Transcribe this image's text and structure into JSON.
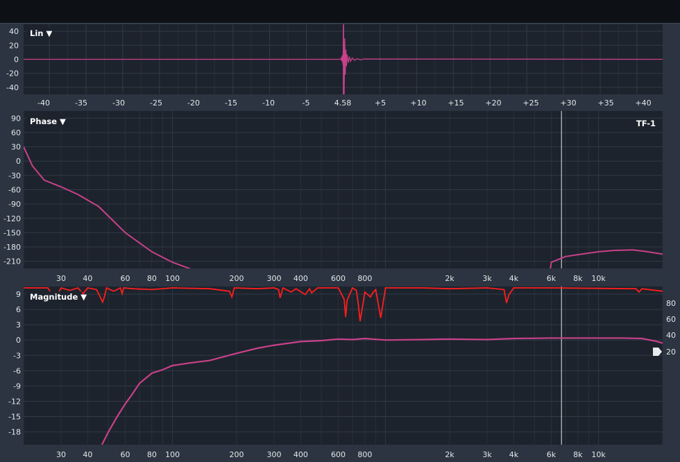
{
  "chart_data": [
    {
      "type": "line",
      "title": "Lin",
      "mode_label": "Lin ▼",
      "xlim": [
        -43.5,
        43.5
      ],
      "ylim": [
        -50,
        50
      ],
      "y_ticks": [
        "40",
        "20",
        "0",
        "-20",
        "-40"
      ],
      "x_ticks": [
        "-40",
        "-35",
        "-30",
        "-25",
        "-20",
        "-15",
        "-10",
        "-5",
        "4.58",
        "+5",
        "+10",
        "+15",
        "+20",
        "+25",
        "+30",
        "+35",
        "+40"
      ],
      "grid": true,
      "impulse_peak_time": 4.58,
      "series": [
        {
          "x": [
            -43.5,
            2.9,
            3.0,
            3.1,
            3.2,
            3.3,
            3.4,
            3.5,
            3.6,
            3.7,
            3.8,
            3.9,
            4.0,
            4.2,
            4.4,
            4.6,
            4.9,
            5.3,
            5.8,
            6.3,
            7.0,
            43.5
          ],
          "y": [
            0,
            0,
            2,
            -3,
            6,
            -8,
            48,
            -50,
            30,
            -22,
            14,
            -10,
            7,
            -5,
            4,
            -3,
            2,
            -1.5,
            1,
            -0.7,
            0.5,
            0
          ]
        }
      ]
    },
    {
      "type": "line",
      "title": "Phase",
      "mode_label": "Phase ▼",
      "tag": "TF-1",
      "xscale": "log",
      "xlim": [
        20,
        20000
      ],
      "ylim": [
        -225,
        105
      ],
      "y_ticks": [
        "90",
        "60",
        "30",
        "0",
        "-30",
        "-60",
        "-90",
        "-120",
        "-150",
        "-180",
        "-210"
      ],
      "x_ticks": [
        "30",
        "40",
        "60",
        "80",
        "100",
        "200",
        "300",
        "400",
        "600",
        "800",
        "2k",
        "3k",
        "4k",
        "6k",
        "8k",
        "10k"
      ],
      "grid": true,
      "cursor_hz": 6700,
      "series": [
        {
          "x": [
            20,
            22,
            25,
            30,
            36,
            45,
            60,
            80,
            100,
            120,
            150,
            175,
            200,
            260,
            330,
            420,
            560,
            640,
            700,
            800,
            1000,
            1500,
            2000,
            3000,
            4000,
            5000,
            5600,
            6000,
            7000,
            8000,
            10000,
            12000,
            14500,
            17000,
            20000
          ],
          "y": [
            30,
            -10,
            -40,
            -54,
            -70,
            -95,
            -150,
            -190,
            -212,
            -225,
            177,
            168,
            158,
            145,
            135,
            132,
            124,
            125,
            127,
            135,
            136,
            142,
            148,
            151,
            158,
            172,
            179,
            -212,
            -200,
            -196,
            -190,
            -187,
            -186,
            -190,
            -195
          ]
        }
      ]
    },
    {
      "type": "line",
      "title": "Magnitude",
      "mode_label": "Magnitude ▼",
      "xscale": "log",
      "xlim": [
        20,
        20000
      ],
      "ylim": [
        -20.5,
        10.5
      ],
      "y_ticks": [
        "9",
        "6",
        "3",
        "0",
        "-3",
        "-6",
        "-9",
        "-12",
        "-15",
        "-18"
      ],
      "y2_ticks": [
        "80",
        "60",
        "40",
        "20"
      ],
      "y2lim": [
        11,
        100
      ],
      "x_ticks": [
        "30",
        "40",
        "60",
        "80",
        "100",
        "200",
        "300",
        "400",
        "600",
        "800",
        "2k",
        "3k",
        "4k",
        "6k",
        "8k",
        "10k"
      ],
      "grid": true,
      "cursor_hz": 6700,
      "series": [
        {
          "name": "Magnitude",
          "x": [
            46,
            50,
            55,
            60,
            65,
            70,
            80,
            90,
            100,
            120,
            150,
            200,
            250,
            300,
            400,
            500,
            600,
            700,
            800,
            1000,
            1500,
            2000,
            3000,
            4000,
            6000,
            8000,
            10000,
            13000,
            16000,
            18500,
            20000
          ],
          "y": [
            -21,
            -18,
            -15,
            -12.5,
            -10.5,
            -8.5,
            -6.5,
            -5.8,
            -5,
            -4.5,
            -4,
            -2.6,
            -1.6,
            -1,
            -0.3,
            -0.1,
            0.2,
            0.1,
            0.3,
            0,
            0.1,
            0.2,
            0.1,
            0.3,
            0.4,
            0.4,
            0.4,
            0.4,
            0.3,
            -0.2,
            -0.6
          ]
        },
        {
          "name": "Coherence",
          "axis": "right",
          "x": [
            20,
            26,
            28,
            30,
            33,
            36,
            38,
            40,
            44,
            47,
            48,
            49,
            53,
            57,
            58,
            59,
            65,
            80,
            100,
            150,
            185,
            190,
            195,
            250,
            300,
            315,
            320,
            330,
            360,
            380,
            420,
            440,
            450,
            480,
            600,
            640,
            650,
            660,
            700,
            730,
            745,
            760,
            800,
            850,
            870,
            900,
            950,
            1000,
            1500,
            2000,
            3000,
            3600,
            3700,
            3800,
            4000,
            6000,
            15000,
            15500,
            16000,
            20000
          ],
          "y": [
            99,
            99,
            86,
            99,
            96,
            99,
            92,
            99,
            97,
            82,
            89,
            99,
            95,
            99,
            92,
            99,
            98,
            97,
            99,
            98,
            95,
            88,
            99,
            98,
            99,
            97,
            87,
            99,
            94,
            98,
            91,
            98,
            93,
            99,
            99,
            85,
            64,
            84,
            99,
            96,
            80,
            59,
            94,
            88,
            93,
            97,
            63,
            99,
            99,
            98,
            99,
            97,
            81,
            91,
            99,
            99,
            98,
            94,
            98,
            95
          ]
        }
      ]
    }
  ]
}
